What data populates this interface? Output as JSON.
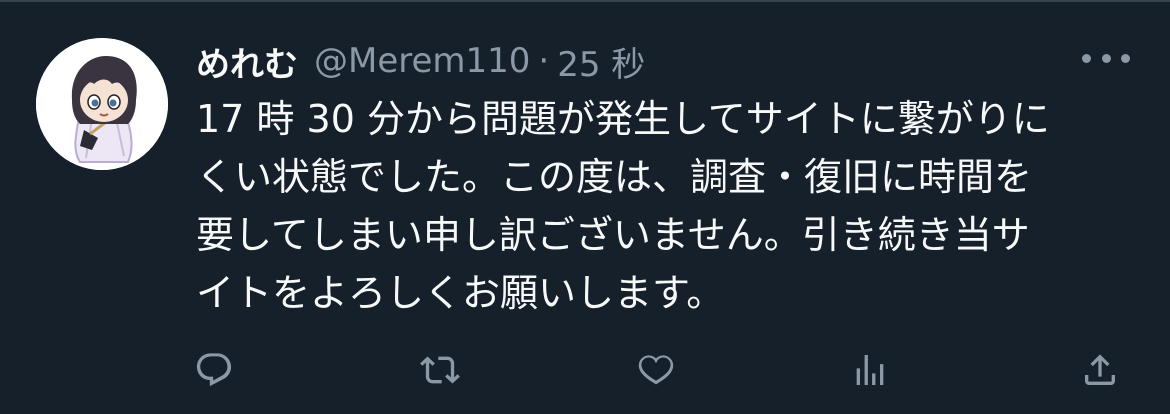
{
  "tweet": {
    "display_name": "めれむ",
    "handle": "@Merem110",
    "separator": "·",
    "time": "25 秒",
    "body_lines": [
      "17 時 30 分から問題が発生してサイトに繋がりに",
      "くい状態でした。この度は、調査・復旧に時間を",
      "要してしまい申し訳ございません。引き続き当サ",
      "イトをよろしくお願いします。"
    ]
  },
  "icons": {
    "avatar": "anime-character-avatar",
    "more": "more-icon",
    "reply": "reply-icon",
    "retweet": "retweet-icon",
    "like": "like-icon",
    "analytics": "analytics-icon",
    "share": "share-icon"
  },
  "colors": {
    "background": "#15202b",
    "primary_text": "#f7f9f9",
    "secondary_text": "#8b98a5",
    "border": "#38444d"
  }
}
